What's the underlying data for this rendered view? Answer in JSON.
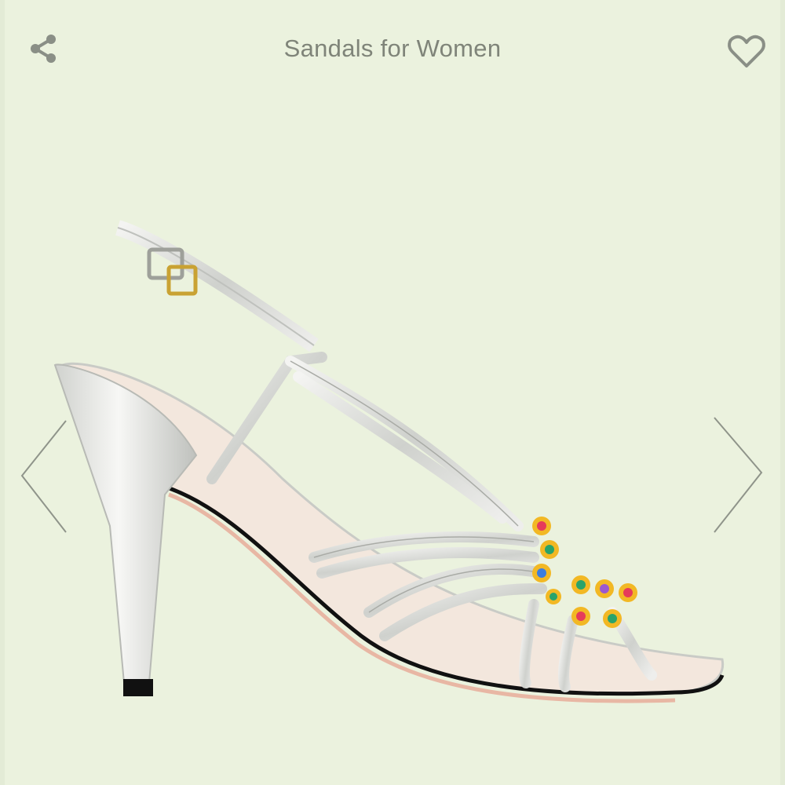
{
  "header": {
    "title": "Sandals for Women",
    "share_icon": "share-icon",
    "favorite_icon": "heart-outline-icon"
  },
  "gallery": {
    "prev_icon": "chevron-left-icon",
    "next_icon": "chevron-right-icon",
    "image_subject": "silver metallic strappy high-heel sandal with crystal embellishment"
  },
  "colors": {
    "background": "#ebf2de",
    "icon_gray": "#8a8f86",
    "metallic_silver": "#d9dbd8",
    "crystal_accents": [
      "#e63b5a",
      "#2aa36b",
      "#3b7de0",
      "#f2b824",
      "#9b59d0"
    ]
  }
}
